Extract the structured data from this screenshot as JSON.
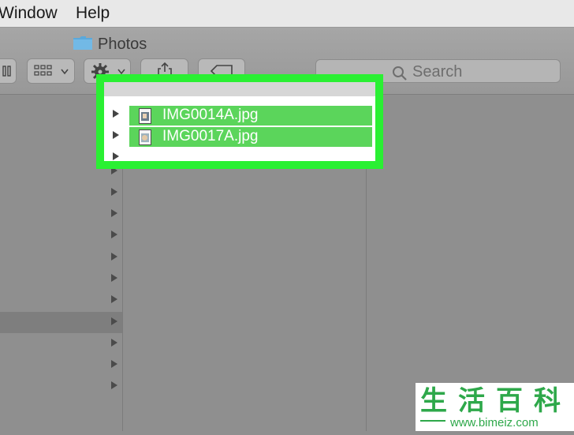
{
  "menu": {
    "window": "Window",
    "help": "Help"
  },
  "window": {
    "title": "Photos"
  },
  "search": {
    "placeholder": "Search"
  },
  "files": [
    {
      "name": "IMG0014A.jpg"
    },
    {
      "name": "IMG0017A.jpg"
    }
  ],
  "colors": {
    "highlight": "#2af033",
    "selected_row": "#5bd55b"
  },
  "watermark": {
    "chars": "生活百科",
    "url": "www.bimeiz.com"
  }
}
